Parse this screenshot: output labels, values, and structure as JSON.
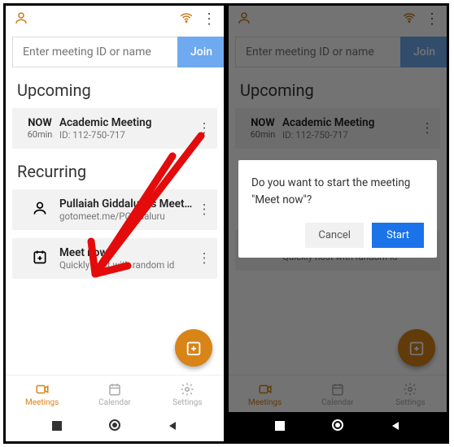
{
  "colors": {
    "accent": "#d88417",
    "join": "#6fa9ef",
    "primary_blue": "#1a73e8"
  },
  "search": {
    "placeholder": "Enter meeting ID or name",
    "join_label": "Join"
  },
  "sections": {
    "upcoming": "Upcoming",
    "recurring": "Recurring"
  },
  "upcoming_item": {
    "badge": "NOW",
    "duration": "60min",
    "title": "Academic Meeting",
    "subtitle": "ID: 112-750-717"
  },
  "recurring_items": [
    {
      "title": "Pullaiah Giddaluru's Meeting",
      "subtitle": "gotomeet.me/PGiddaluru",
      "icon": "person"
    },
    {
      "title": "Meet now",
      "subtitle": "Quickly host with random id",
      "icon": "calendar"
    }
  ],
  "tabs": [
    {
      "label": "Meetings",
      "active": true
    },
    {
      "label": "Calendar",
      "active": false
    },
    {
      "label": "Settings",
      "active": false
    }
  ],
  "dialog": {
    "message": "Do you want to start the meeting \"Meet now\"?",
    "cancel": "Cancel",
    "start": "Start"
  }
}
